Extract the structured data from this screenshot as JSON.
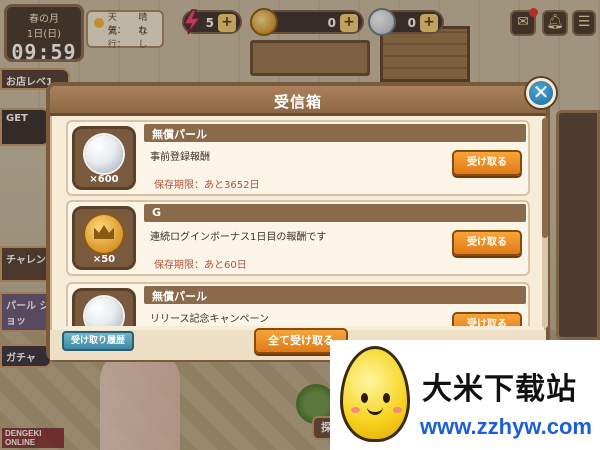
{
  "clock": {
    "season": "春の月",
    "date": "1日(日)",
    "time": "09:59"
  },
  "weather": {
    "label1": "天気：",
    "value1": "晴れ",
    "label2": "流行：",
    "value2": "なし"
  },
  "resources": {
    "energy": {
      "value": "5",
      "plus": "+"
    },
    "gold": {
      "value": "0",
      "plus": "+"
    },
    "pearl": {
      "value": "0",
      "plus": "+"
    }
  },
  "side": {
    "shop": "お店レベ1",
    "video": "GET",
    "challenge": "チャレン",
    "pearl_shop": "パール ショッ",
    "gacha": "ガチャ",
    "explore": "探索",
    "corner_logo": "DENGEKI ONLINE"
  },
  "inbox": {
    "title": "受信箱",
    "close": "✕",
    "claim_label": "受け取る",
    "items": [
      {
        "icon": "pearl-icon",
        "qty": "×600",
        "name": "無償パール",
        "desc": "事前登録報酬",
        "expiry": "保存期限：あと3652日"
      },
      {
        "icon": "coin-icon",
        "qty": "×50",
        "name": "G",
        "desc": "連続ログインボーナス1日目の報酬です",
        "expiry": "保存期限：あと60日"
      },
      {
        "icon": "pearl-icon",
        "qty": "",
        "name": "無償パール",
        "desc": "リリース記念キャンペーン",
        "expiry": ""
      }
    ],
    "history_button": "受け取り履歴",
    "claim_all_button": "全て受け取る"
  },
  "watermark": {
    "name": "大米下载站",
    "url": "www.zzhyw.com"
  },
  "colors": {
    "accent": "#e07a17",
    "header": "#8d6746",
    "close": "#1f6c9b",
    "expiry": "#b2503d"
  }
}
